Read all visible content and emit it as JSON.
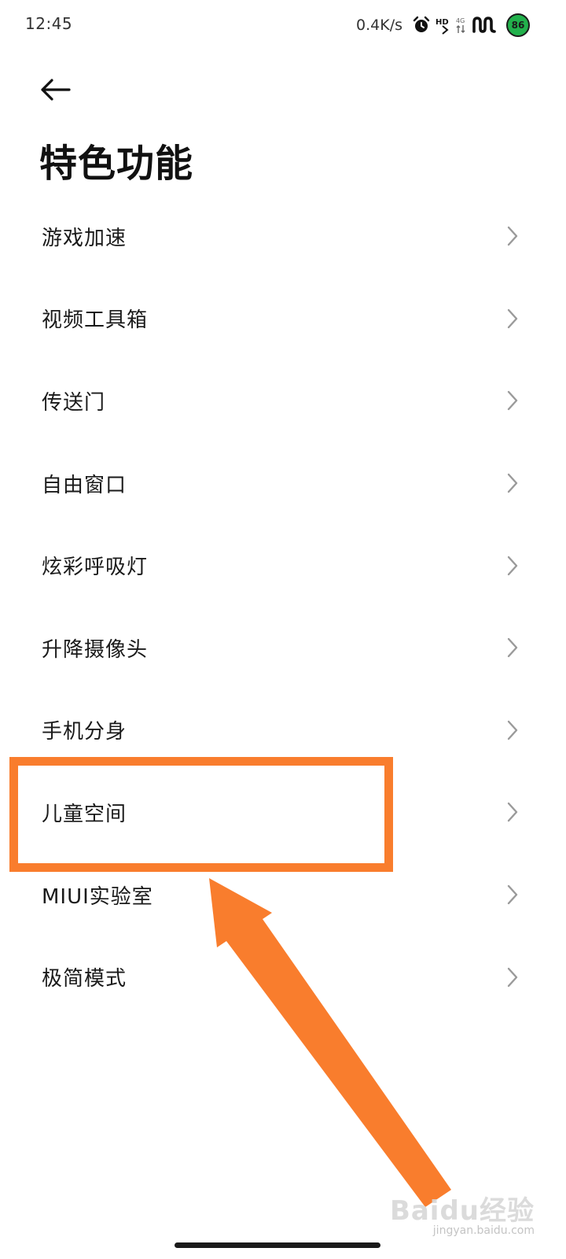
{
  "status_bar": {
    "time": "12:45",
    "net_speed": "0.4K/s",
    "hd_label": "HD",
    "signal_label": "4G",
    "battery_level": "86",
    "battery_color": "#22b14c"
  },
  "header": {
    "back_icon": "arrow-left-icon",
    "title": "特色功能"
  },
  "menu": {
    "items": [
      {
        "label": "游戏加速"
      },
      {
        "label": "视频工具箱"
      },
      {
        "label": "传送门"
      },
      {
        "label": "自由窗口"
      },
      {
        "label": "炫彩呼吸灯"
      },
      {
        "label": "升降摄像头"
      },
      {
        "label": "手机分身"
      },
      {
        "label": "儿童空间"
      },
      {
        "label": "MIUI实验室"
      },
      {
        "label": "极简模式"
      }
    ],
    "chevron_icon": "chevron-right-icon"
  },
  "annotation": {
    "highlight_color": "#f97d2d",
    "highlighted_item": "儿童空间"
  },
  "watermark": {
    "logo": "Baidu经验",
    "url": "jingyan.baidu.com"
  }
}
